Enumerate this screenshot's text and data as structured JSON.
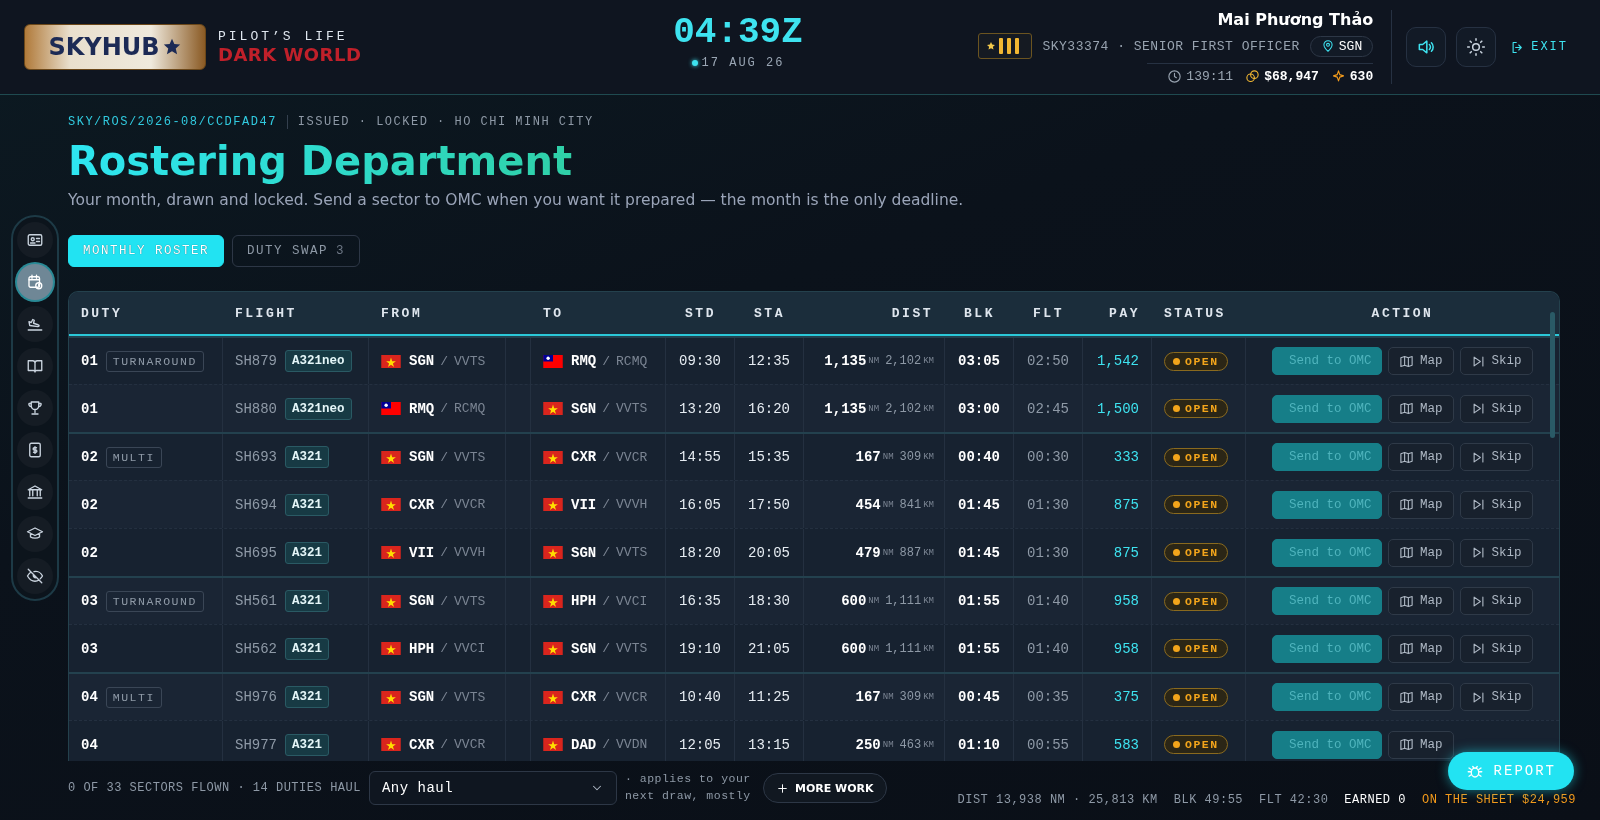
{
  "header": {
    "logo": {
      "text": "SKYHUB"
    },
    "tagline": "PILOT’S LIFE",
    "world": "DARK WORLD",
    "clock": "04:39Z",
    "date": "17 AUG 26",
    "pilot": {
      "name": "Mai Phương Thảo",
      "id_line": "SKY33374 · SENIOR FIRST OFFICER",
      "base": "SGN",
      "hours": "139:11",
      "money": "$68,947",
      "points": "630"
    },
    "controls": [
      {
        "kind": "sound"
      },
      {
        "kind": "theme"
      }
    ],
    "exit": "EXIT"
  },
  "sidebar": {
    "items": [
      {
        "kind": "id-card",
        "selected": false
      },
      {
        "kind": "calendar",
        "selected": true
      },
      {
        "kind": "landing",
        "selected": false
      },
      {
        "kind": "book",
        "selected": false
      },
      {
        "kind": "trophy",
        "selected": false
      },
      {
        "kind": "payslip",
        "selected": false
      },
      {
        "kind": "bank",
        "selected": false
      },
      {
        "kind": "school",
        "selected": false
      },
      {
        "kind": "hidden",
        "selected": false
      }
    ]
  },
  "page": {
    "reference": "SKY/ROS/2026-08/CCDFAD47",
    "meta": "ISSUED · LOCKED · HO CHI MINH CITY",
    "title": "Rostering Department",
    "subtitle": "Your month, drawn and locked. Send a sector to OMC when you want it prepared — the month is the only deadline."
  },
  "tabs": [
    {
      "label": "MONTHLY ROSTER",
      "selected": true
    },
    {
      "label": "DUTY SWAP",
      "count": "3",
      "selected": false
    }
  ],
  "table": {
    "columns": [
      "DUTY",
      "FLIGHT",
      "FROM",
      "TO",
      "STD",
      "STA",
      "DIST",
      "BLK",
      "FLT",
      "PAY",
      "STATUS",
      "ACTION"
    ],
    "duties": [
      {
        "type": "TURNAROUND",
        "sectors": [
          {
            "duty": "01",
            "flight": "SH879",
            "aircraft": "A321neo",
            "from": {
              "kind": "vn",
              "iata": "SGN",
              "sep": "/",
              "icao": "VVTS"
            },
            "to": {
              "kind": "tw",
              "iata": "RMQ",
              "sep": "/",
              "icao": "RCMQ"
            },
            "std": "09:30",
            "sta": "12:35",
            "nm": "1,135",
            "nm_unit": "NM",
            "km": "2,102",
            "km_unit": "KM",
            "blk": "03:05",
            "flt": "02:50",
            "pay": "1,542",
            "status": {
              "kind": "open",
              "label": "OPEN"
            },
            "actions": [
              {
                "kind": "send",
                "label": "Send to OMC",
                "disabled": true
              },
              {
                "kind": "map",
                "label": "Map",
                "disabled": false
              },
              {
                "kind": "skip",
                "label": "Skip",
                "disabled": false
              }
            ]
          },
          {
            "duty": "01",
            "flight": "SH880",
            "aircraft": "A321neo",
            "from": {
              "kind": "tw",
              "iata": "RMQ",
              "sep": "/",
              "icao": "RCMQ"
            },
            "to": {
              "kind": "vn",
              "iata": "SGN",
              "sep": "/",
              "icao": "VVTS"
            },
            "std": "13:20",
            "sta": "16:20",
            "nm": "1,135",
            "nm_unit": "NM",
            "km": "2,102",
            "km_unit": "KM",
            "blk": "03:00",
            "flt": "02:45",
            "pay": "1,500",
            "status": {
              "kind": "open",
              "label": "OPEN"
            },
            "actions": [
              {
                "kind": "send",
                "label": "Send to OMC",
                "disabled": true
              },
              {
                "kind": "map",
                "label": "Map",
                "disabled": false
              },
              {
                "kind": "skip",
                "label": "Skip",
                "disabled": false
              }
            ]
          }
        ]
      },
      {
        "type": "MULTI",
        "sectors": [
          {
            "duty": "02",
            "flight": "SH693",
            "aircraft": "A321",
            "from": {
              "kind": "vn",
              "iata": "SGN",
              "sep": "/",
              "icao": "VVTS"
            },
            "to": {
              "kind": "vn",
              "iata": "CXR",
              "sep": "/",
              "icao": "VVCR"
            },
            "std": "14:55",
            "sta": "15:35",
            "nm": "167",
            "nm_unit": "NM",
            "km": "309",
            "km_unit": "KM",
            "blk": "00:40",
            "flt": "00:30",
            "pay": "333",
            "status": {
              "kind": "open",
              "label": "OPEN"
            },
            "actions": [
              {
                "kind": "send",
                "label": "Send to OMC",
                "disabled": true
              },
              {
                "kind": "map",
                "label": "Map",
                "disabled": false
              },
              {
                "kind": "skip",
                "label": "Skip",
                "disabled": false
              }
            ]
          },
          {
            "duty": "02",
            "flight": "SH694",
            "aircraft": "A321",
            "from": {
              "kind": "vn",
              "iata": "CXR",
              "sep": "/",
              "icao": "VVCR"
            },
            "to": {
              "kind": "vn",
              "iata": "VII",
              "sep": "/",
              "icao": "VVVH"
            },
            "std": "16:05",
            "sta": "17:50",
            "nm": "454",
            "nm_unit": "NM",
            "km": "841",
            "km_unit": "KM",
            "blk": "01:45",
            "flt": "01:30",
            "pay": "875",
            "status": {
              "kind": "open",
              "label": "OPEN"
            },
            "actions": [
              {
                "kind": "send",
                "label": "Send to OMC",
                "disabled": true
              },
              {
                "kind": "map",
                "label": "Map",
                "disabled": false
              },
              {
                "kind": "skip",
                "label": "Skip",
                "disabled": false
              }
            ]
          },
          {
            "duty": "02",
            "flight": "SH695",
            "aircraft": "A321",
            "from": {
              "kind": "vn",
              "iata": "VII",
              "sep": "/",
              "icao": "VVVH"
            },
            "to": {
              "kind": "vn",
              "iata": "SGN",
              "sep": "/",
              "icao": "VVTS"
            },
            "std": "18:20",
            "sta": "20:05",
            "nm": "479",
            "nm_unit": "NM",
            "km": "887",
            "km_unit": "KM",
            "blk": "01:45",
            "flt": "01:30",
            "pay": "875",
            "status": {
              "kind": "open",
              "label": "OPEN"
            },
            "actions": [
              {
                "kind": "send",
                "label": "Send to OMC",
                "disabled": true
              },
              {
                "kind": "map",
                "label": "Map",
                "disabled": false
              },
              {
                "kind": "skip",
                "label": "Skip",
                "disabled": false
              }
            ]
          }
        ]
      },
      {
        "type": "TURNAROUND",
        "sectors": [
          {
            "duty": "03",
            "flight": "SH561",
            "aircraft": "A321",
            "from": {
              "kind": "vn",
              "iata": "SGN",
              "sep": "/",
              "icao": "VVTS"
            },
            "to": {
              "kind": "vn",
              "iata": "HPH",
              "sep": "/",
              "icao": "VVCI"
            },
            "std": "16:35",
            "sta": "18:30",
            "nm": "600",
            "nm_unit": "NM",
            "km": "1,111",
            "km_unit": "KM",
            "blk": "01:55",
            "flt": "01:40",
            "pay": "958",
            "status": {
              "kind": "open",
              "label": "OPEN"
            },
            "actions": [
              {
                "kind": "send",
                "label": "Send to OMC",
                "disabled": true
              },
              {
                "kind": "map",
                "label": "Map",
                "disabled": false
              },
              {
                "kind": "skip",
                "label": "Skip",
                "disabled": false
              }
            ]
          },
          {
            "duty": "03",
            "flight": "SH562",
            "aircraft": "A321",
            "from": {
              "kind": "vn",
              "iata": "HPH",
              "sep": "/",
              "icao": "VVCI"
            },
            "to": {
              "kind": "vn",
              "iata": "SGN",
              "sep": "/",
              "icao": "VVTS"
            },
            "std": "19:10",
            "sta": "21:05",
            "nm": "600",
            "nm_unit": "NM",
            "km": "1,111",
            "km_unit": "KM",
            "blk": "01:55",
            "flt": "01:40",
            "pay": "958",
            "status": {
              "kind": "open",
              "label": "OPEN"
            },
            "actions": [
              {
                "kind": "send",
                "label": "Send to OMC",
                "disabled": true
              },
              {
                "kind": "map",
                "label": "Map",
                "disabled": false
              },
              {
                "kind": "skip",
                "label": "Skip",
                "disabled": false
              }
            ]
          }
        ]
      },
      {
        "type": "MULTI",
        "sectors": [
          {
            "duty": "04",
            "flight": "SH976",
            "aircraft": "A321",
            "from": {
              "kind": "vn",
              "iata": "SGN",
              "sep": "/",
              "icao": "VVTS"
            },
            "to": {
              "kind": "vn",
              "iata": "CXR",
              "sep": "/",
              "icao": "VVCR"
            },
            "std": "10:40",
            "sta": "11:25",
            "nm": "167",
            "nm_unit": "NM",
            "km": "309",
            "km_unit": "KM",
            "blk": "00:45",
            "flt": "00:35",
            "pay": "375",
            "status": {
              "kind": "open",
              "label": "OPEN"
            },
            "actions": [
              {
                "kind": "send",
                "label": "Send to OMC",
                "disabled": true
              },
              {
                "kind": "map",
                "label": "Map",
                "disabled": false
              },
              {
                "kind": "skip",
                "label": "Skip",
                "disabled": false
              }
            ]
          },
          {
            "duty": "04",
            "flight": "SH977",
            "aircraft": "A321",
            "from": {
              "kind": "vn",
              "iata": "CXR",
              "sep": "/",
              "icao": "VVCR"
            },
            "to": {
              "kind": "vn",
              "iata": "DAD",
              "sep": "/",
              "icao": "VVDN"
            },
            "std": "12:05",
            "sta": "13:15",
            "nm": "250",
            "nm_unit": "NM",
            "km": "463",
            "km_unit": "KM",
            "blk": "01:10",
            "flt": "00:55",
            "pay": "583",
            "status": {
              "kind": "open",
              "label": "OPEN"
            },
            "actions": [
              {
                "kind": "send",
                "label": "Send to OMC",
                "disabled": true
              },
              {
                "kind": "map",
                "label": "Map",
                "disabled": false
              }
            ]
          }
        ]
      }
    ]
  },
  "footer": {
    "progress": "0 OF 33 SECTORS FLOWN · 14 DUTIES",
    "haul_label": "HAUL",
    "haul_value": "Any haul",
    "note": "· applies to your next draw, mostly",
    "more_work": "MORE WORK",
    "totals": [
      {
        "kind": "plain",
        "text": "DIST 13,938 NM · 25,813 KM"
      },
      {
        "kind": "plain",
        "text": "BLK 49:55"
      },
      {
        "kind": "plain",
        "text": "FLT 42:30"
      },
      {
        "kind": "earned",
        "text": "EARNED 0"
      },
      {
        "kind": "sheet",
        "text": "ON THE SHEET $24,959"
      }
    ]
  },
  "report_button": "REPORT"
}
